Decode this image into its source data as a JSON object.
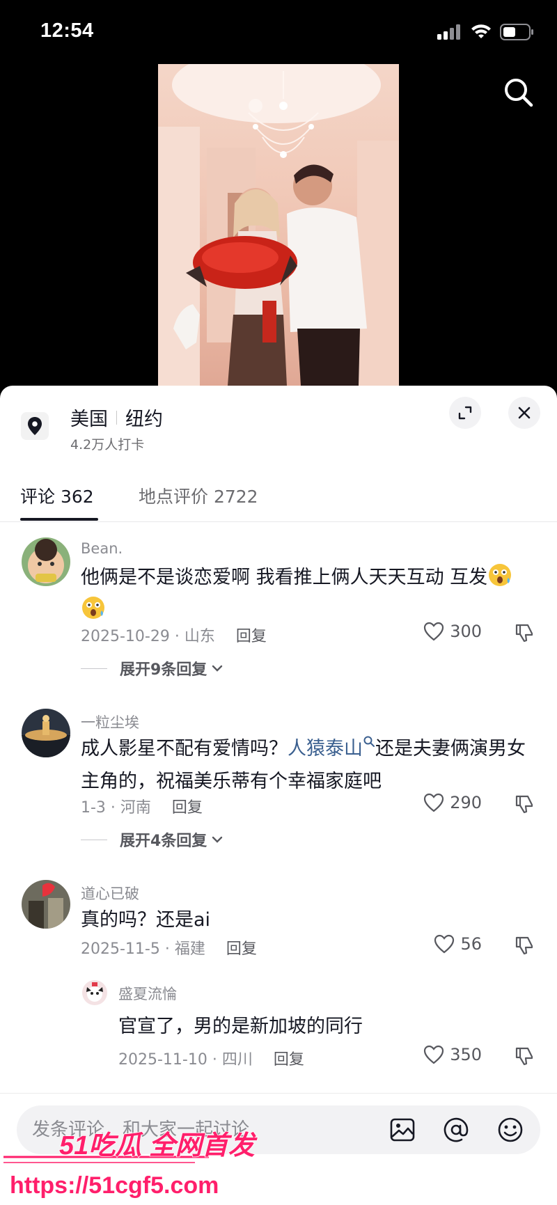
{
  "status": {
    "time": "12:54"
  },
  "location": {
    "country": "美国",
    "city": "纽约",
    "checkins": "4.2万人打卡"
  },
  "tabs": [
    {
      "label": "评论 362",
      "active": true
    },
    {
      "label": "地点评价 2722",
      "active": false
    }
  ],
  "comments": [
    {
      "user": "Bean.",
      "text": "他俩是不是谈恋爱啊 我看推上俩人天天互动 互发",
      "date": "2025-10-29 · 山东",
      "reply_label": "回复",
      "likes": "300",
      "expand": "展开9条回复"
    },
    {
      "user": "一粒尘埃",
      "text_before": "成人影星不配有爱情吗？",
      "hashtag": "人猿泰山",
      "text_after": "还是夫妻俩演男女主角的，祝福美乐蒂有个幸福家庭吧",
      "date": "1-3 · 河南",
      "reply_label": "回复",
      "likes": "290",
      "expand": "展开4条回复"
    },
    {
      "user": "道心已破",
      "text": "真的吗？还是ai",
      "date": "2025-11-5 · 福建",
      "reply_label": "回复",
      "likes": "56",
      "sub_reply": {
        "user": "盛夏流惀",
        "text": "官宣了，男的是新加坡的同行",
        "date": "2025-11-10 · 四川",
        "reply_label": "回复",
        "likes": "350"
      }
    }
  ],
  "input": {
    "placeholder": "发条评论，和大家一起讨论"
  },
  "watermark": {
    "brand": "51吃瓜 全网首发",
    "url": "https://51cgf5.com"
  },
  "icons": [
    "signal-icon",
    "wifi-icon",
    "battery-icon",
    "search-icon",
    "location-pin-icon",
    "expand-icon",
    "close-icon",
    "heart-icon",
    "dislike-icon",
    "chevron-down-icon",
    "image-icon",
    "at-icon",
    "emoji-icon"
  ],
  "colors": {
    "hashtag": "#3a5f8f",
    "watermark": "#ff1f6b",
    "text": "#161823",
    "muted": "#8a8b91"
  }
}
